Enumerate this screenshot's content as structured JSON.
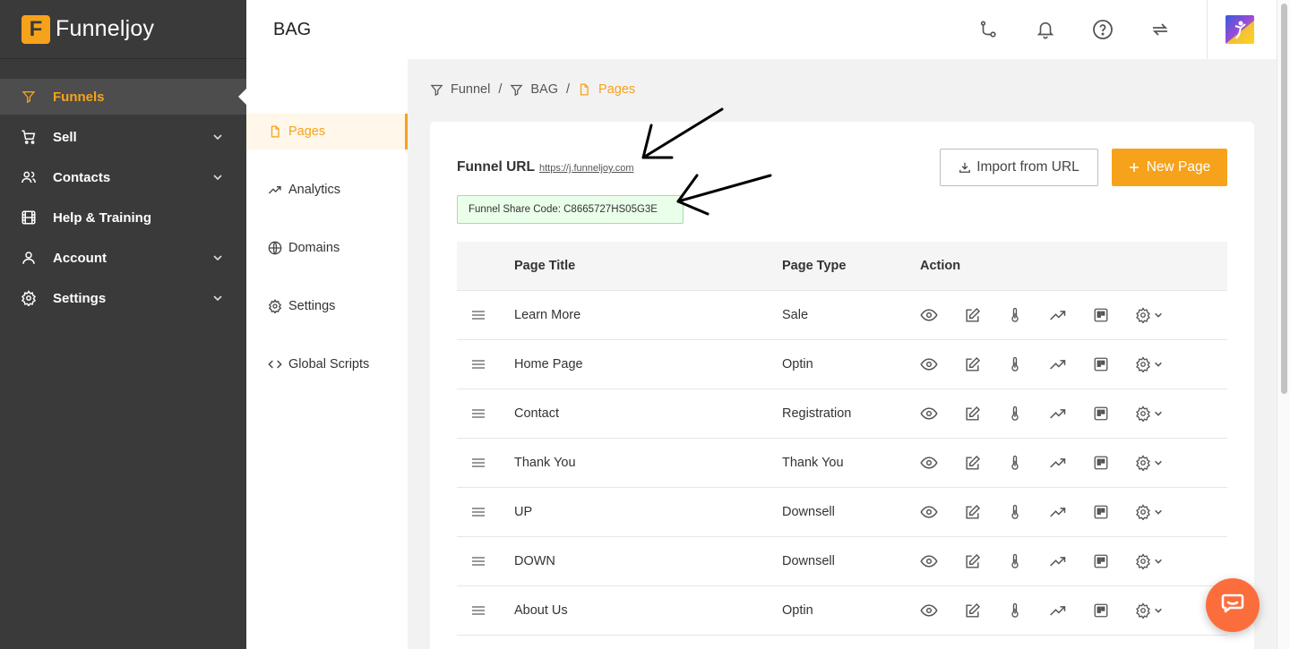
{
  "brand": {
    "logo_letter": "F",
    "name": "Funneljoy",
    "accent": "#f7a21b"
  },
  "sidebar": {
    "items": [
      {
        "label": "Funnels",
        "icon": "filter-icon",
        "active": true
      },
      {
        "label": "Sell",
        "icon": "cart-icon",
        "expandable": true
      },
      {
        "label": "Contacts",
        "icon": "users-icon",
        "expandable": true
      },
      {
        "label": "Help & Training",
        "icon": "film-icon"
      },
      {
        "label": "Account",
        "icon": "user-icon",
        "expandable": true
      },
      {
        "label": "Settings",
        "icon": "gear-icon",
        "expandable": true
      }
    ]
  },
  "header": {
    "title": "BAG",
    "icons": [
      "git-branch-icon",
      "bell-icon",
      "help-circle-icon",
      "refresh-icon",
      "avatar"
    ]
  },
  "subnav": {
    "items": [
      {
        "label": "Pages",
        "icon": "file-icon",
        "active": true
      },
      {
        "label": "Analytics",
        "icon": "trending-up-icon"
      },
      {
        "label": "Domains",
        "icon": "globe-icon"
      },
      {
        "label": "Settings",
        "icon": "gear-icon"
      },
      {
        "label": "Global Scripts",
        "icon": "code-icon"
      }
    ]
  },
  "breadcrumb": {
    "items": [
      {
        "label": "Funnel",
        "icon": "filter-icon"
      },
      {
        "label": "BAG",
        "icon": "filter-icon"
      },
      {
        "label": "Pages",
        "icon": "file-icon",
        "current": true
      }
    ],
    "separator": "/"
  },
  "funnel": {
    "url_label": "Funnel URL",
    "url": "https://j.funneljoy.com",
    "share_code": "Funnel Share Code: C8665727HS05G3E"
  },
  "actions": {
    "import_label": "Import from URL",
    "new_page_label": "New Page"
  },
  "table": {
    "headers": {
      "title": "Page Title",
      "type": "Page Type",
      "action": "Action"
    },
    "action_icons": [
      "eye-icon",
      "edit-icon",
      "thermometer-icon",
      "trending-up-icon",
      "split-icon",
      "gear-icon"
    ],
    "rows": [
      {
        "title": "Learn More",
        "type": "Sale"
      },
      {
        "title": "Home Page",
        "type": "Optin"
      },
      {
        "title": "Contact",
        "type": "Registration"
      },
      {
        "title": "Thank You",
        "type": "Thank You"
      },
      {
        "title": "UP",
        "type": "Downsell"
      },
      {
        "title": "DOWN",
        "type": "Downsell"
      },
      {
        "title": "About Us",
        "type": "Optin"
      }
    ]
  },
  "chat": {
    "icon": "chat-icon",
    "color": "#fc6d3c"
  }
}
